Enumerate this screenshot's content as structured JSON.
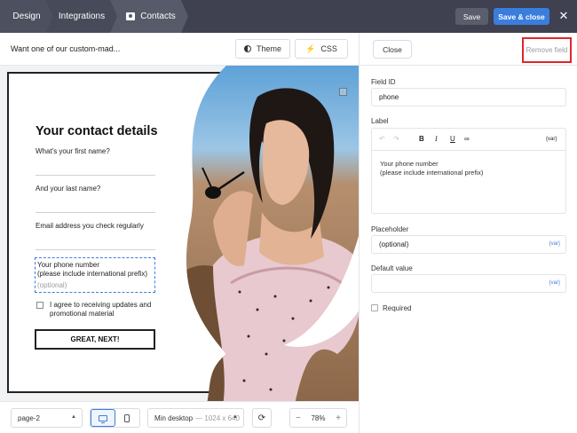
{
  "topbar": {
    "tabs": [
      {
        "label": "Design"
      },
      {
        "label": "Integrations"
      },
      {
        "label": "Contacts"
      }
    ],
    "save_label": "Save",
    "save_close_label": "Save & close",
    "close_glyph": "✕"
  },
  "toolbar": {
    "promo_text": "Want one of our custom-mad...",
    "theme_label": "Theme",
    "css_label": "CSS",
    "close_label": "Close",
    "remove_field_label": "Remove field"
  },
  "form": {
    "title": "Your contact details",
    "questions": [
      "What's your first name?",
      "And your last name?",
      "Email address you check regularly"
    ],
    "phone_label": "Your phone number\n(please include international prefix)",
    "phone_placeholder": "(optional)",
    "checkbox_label": "I agree to receiving updates and promotional material",
    "cta_label": "GREAT, NEXT!"
  },
  "bottombar": {
    "page_select": "page-2",
    "resolution_label": "Min desktop",
    "resolution_value": "— 1024 x 640",
    "zoom": "78%",
    "zoom_minus": "−",
    "zoom_plus": "+"
  },
  "panel": {
    "field_id_label": "Field ID",
    "field_id_value": "phone",
    "label_label": "Label",
    "label_text": "Your phone number\n(please include international prefix)",
    "var_tag": "{var}",
    "placeholder_label": "Placeholder",
    "placeholder_value": "(optional)",
    "default_label": "Default value",
    "default_value": "",
    "required_label": "Required"
  },
  "colors": {
    "accent": "#3b7ddd",
    "topbar": "#3f4150",
    "highlight": "#e0262b"
  },
  "icons": [
    "contact-card-icon",
    "theme-icon",
    "bolt-icon",
    "undo-icon",
    "redo-icon",
    "bold-icon",
    "italic-icon",
    "underline-icon",
    "link-icon",
    "desktop-icon",
    "mobile-icon",
    "sync-icon",
    "close-icon"
  ]
}
